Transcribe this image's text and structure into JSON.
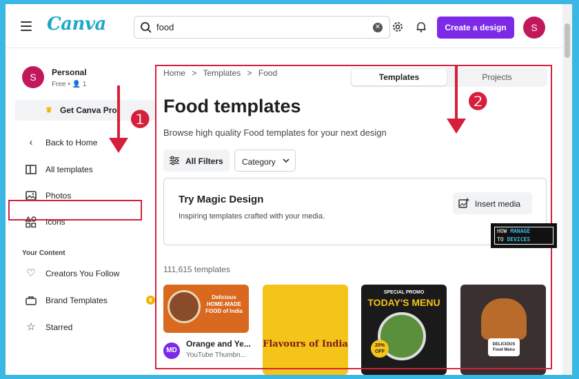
{
  "topbar": {
    "logo": "Canva",
    "search_value": "food",
    "create_label": "Create a design",
    "avatar_initial": "S"
  },
  "sidebar": {
    "avatar_initial": "S",
    "account_name": "Personal",
    "account_sub": "Free • 👤 1",
    "pro_label": "Get Canva Pro",
    "items": [
      {
        "label": "Back to Home",
        "icon": "chevron-left-icon"
      },
      {
        "label": "All templates",
        "icon": "templates-icon"
      },
      {
        "label": "Photos",
        "icon": "photo-icon"
      },
      {
        "label": "Icons",
        "icon": "shapes-icon"
      }
    ],
    "section_title": "Your Content",
    "content_items": [
      {
        "label": "Creators You Follow",
        "icon": "heart-icon"
      },
      {
        "label": "Brand Templates",
        "icon": "brand-icon"
      },
      {
        "label": "Starred",
        "icon": "star-icon"
      }
    ]
  },
  "main": {
    "breadcrumb": [
      "Home",
      ">",
      "Templates",
      ">",
      "Food"
    ],
    "tabs": [
      "Templates",
      "Projects"
    ],
    "title": "Food templates",
    "subtitle": "Browse high quality Food templates for your next design",
    "filters_label": "All Filters",
    "category_label": "Category",
    "magic_title": "Try Magic Design",
    "magic_sub": "Inspiring templates crafted with your media.",
    "insert_label": "Insert media",
    "count": "111,615 templates",
    "cards": [
      {
        "text": "Delicious HOME-MADE FOOD of India"
      },
      {
        "text": "Flavours of India"
      },
      {
        "promo": "SPECIAL PROMO",
        "title": "TODAY'S MENU",
        "off": "20% OFF"
      },
      {
        "text": "DELICIOUS Food Menu"
      }
    ],
    "first_card_avatar": "MD",
    "first_card_title": "Orange and Ye...",
    "first_card_sub": "YouTube Thumbn..."
  },
  "annotations": {
    "step1": "❶",
    "step2": "❷",
    "accent_color": "#d61f3a"
  },
  "watermark": {
    "line1a": "HOW",
    "line1b": "MANAGE",
    "line2a": "TO",
    "line2b": "DEVICES"
  }
}
